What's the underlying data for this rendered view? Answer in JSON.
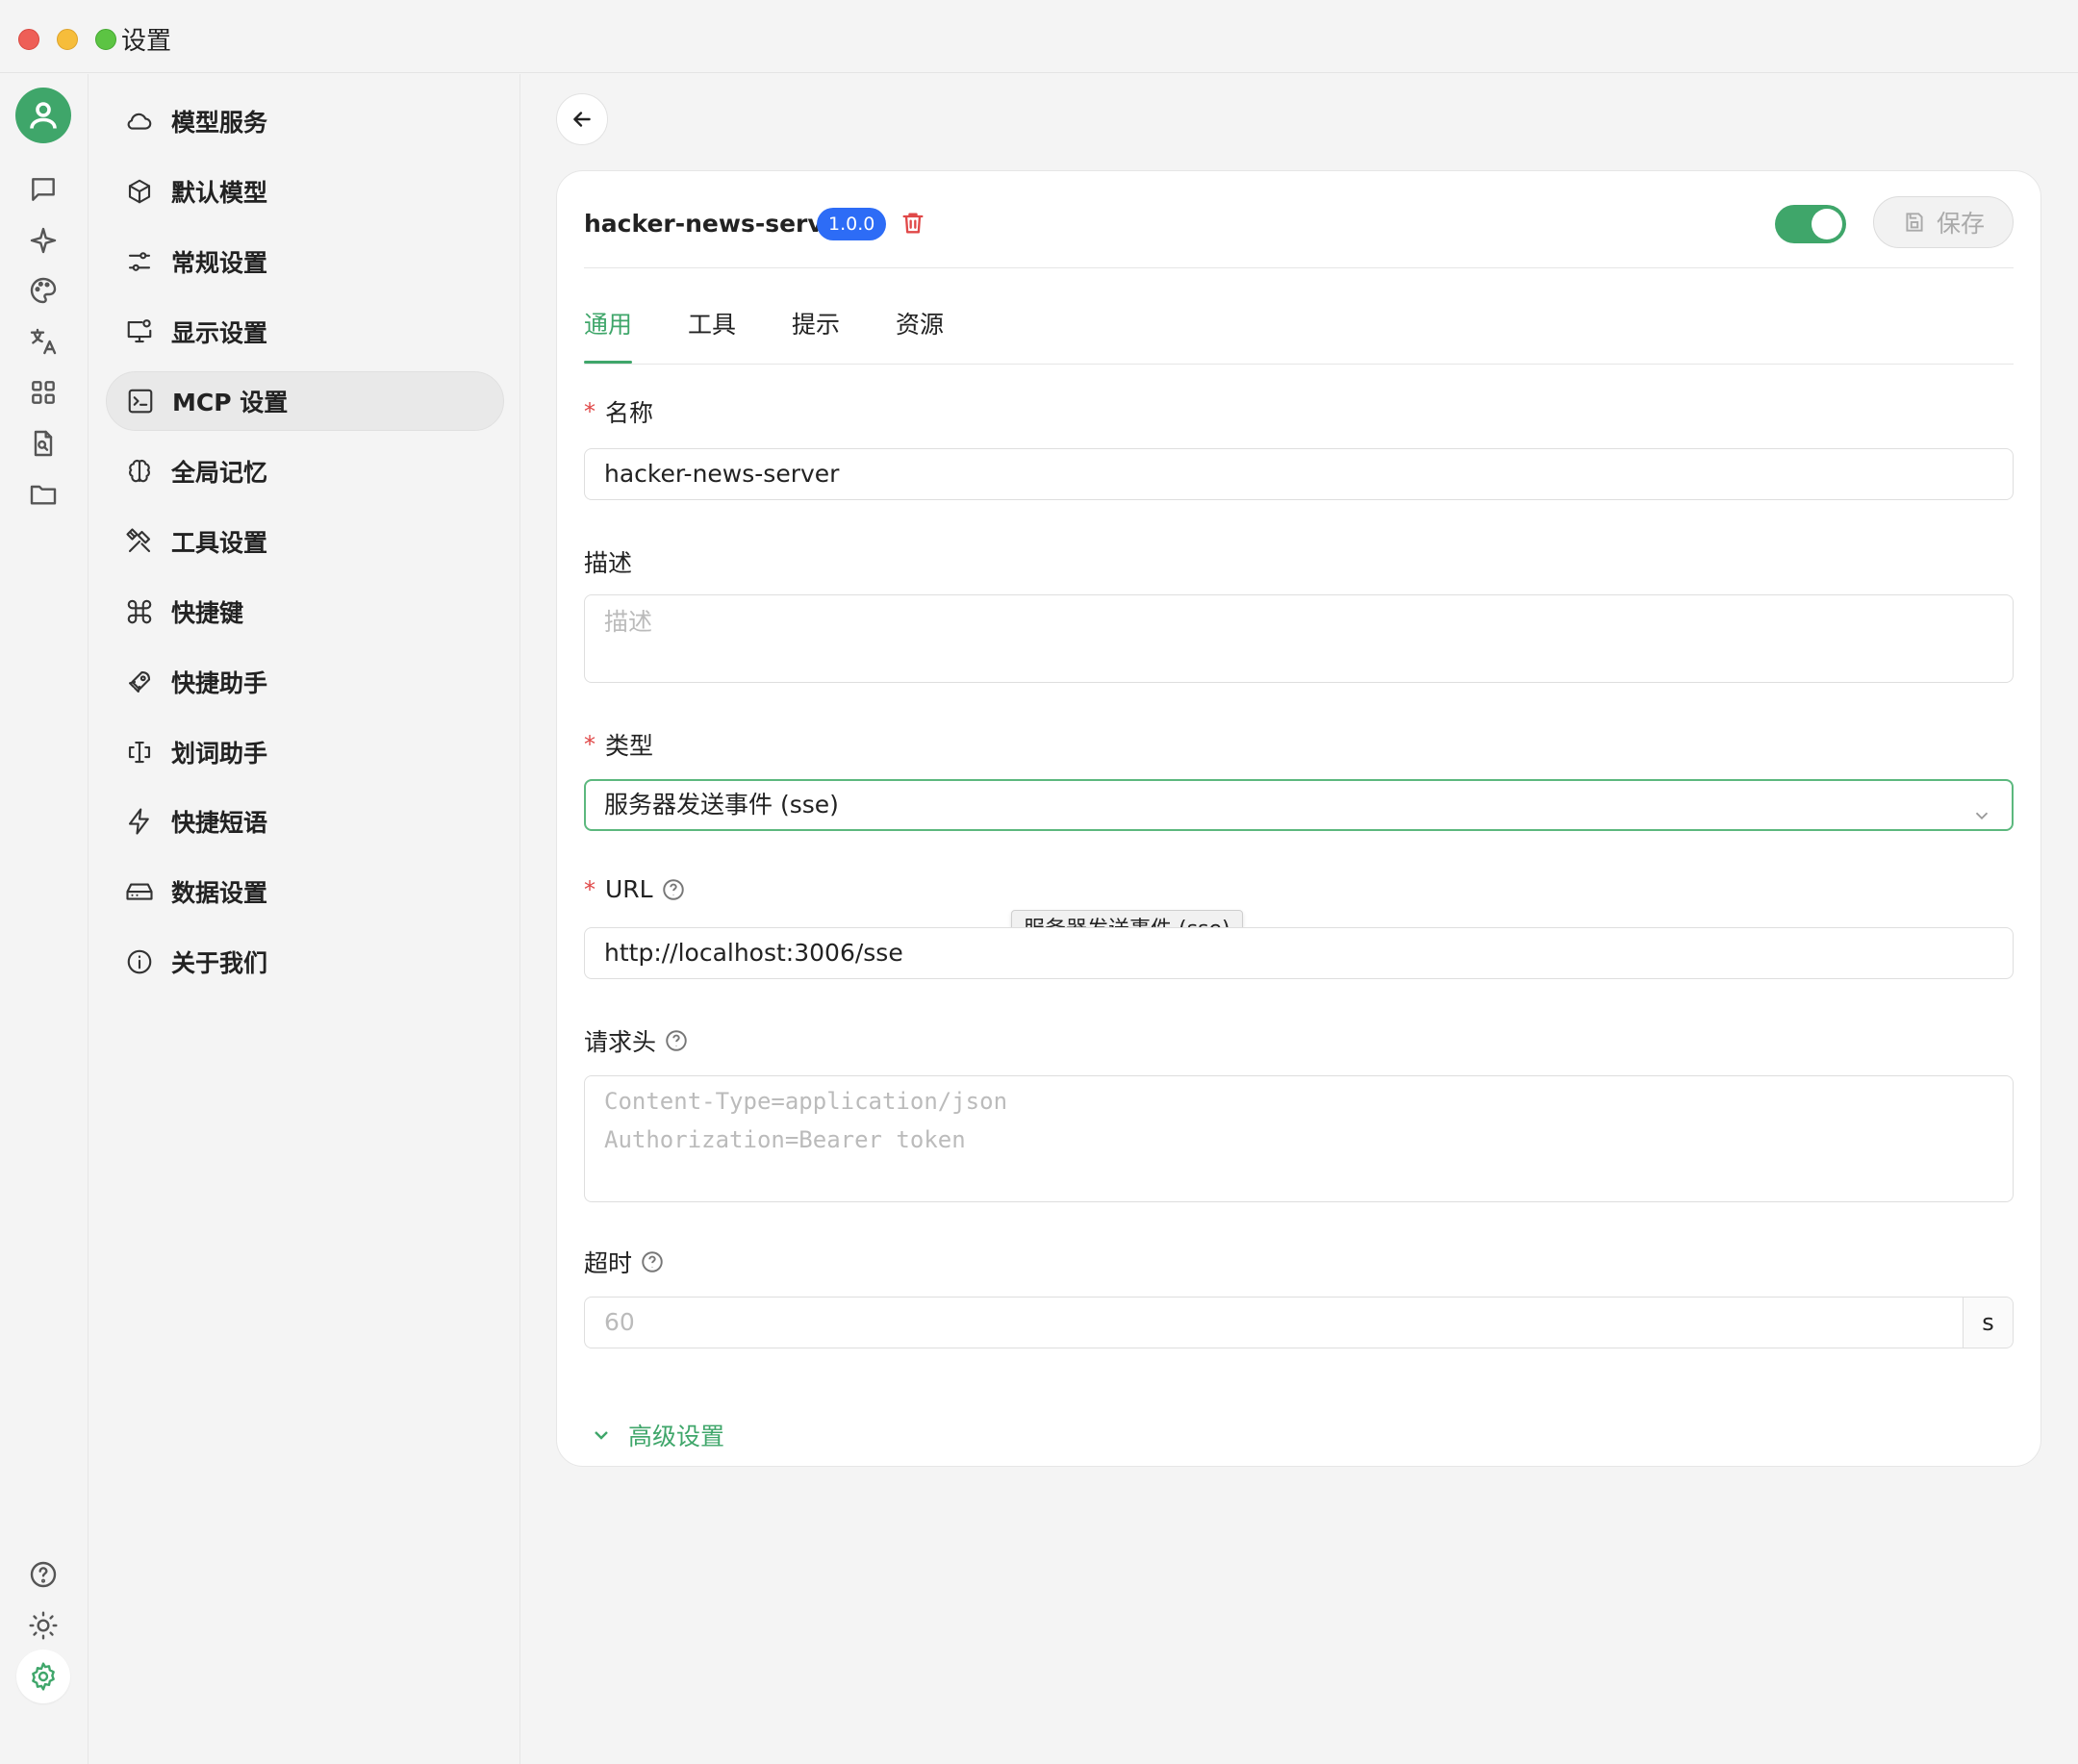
{
  "window": {
    "title": "设置"
  },
  "sidebar": {
    "items": [
      {
        "label": "模型服务",
        "icon": "cloud-icon"
      },
      {
        "label": "默认模型",
        "icon": "cube-icon"
      },
      {
        "label": "常规设置",
        "icon": "sliders-icon"
      },
      {
        "label": "显示设置",
        "icon": "monitor-icon"
      },
      {
        "label": "MCP 设置",
        "icon": "terminal-icon",
        "active": true
      },
      {
        "label": "全局记忆",
        "icon": "brain-icon"
      },
      {
        "label": "工具设置",
        "icon": "tools-icon"
      },
      {
        "label": "快捷键",
        "icon": "command-icon"
      },
      {
        "label": "快捷助手",
        "icon": "rocket-icon"
      },
      {
        "label": "划词助手",
        "icon": "text-cursor-icon"
      },
      {
        "label": "快捷短语",
        "icon": "zap-icon"
      },
      {
        "label": "数据设置",
        "icon": "hard-drive-icon"
      },
      {
        "label": "关于我们",
        "icon": "info-icon"
      }
    ]
  },
  "server": {
    "name": "hacker-news-server",
    "version": "1.0.0",
    "enabled": true,
    "save_label": "保存"
  },
  "tabs": [
    "通用",
    "工具",
    "提示",
    "资源"
  ],
  "form": {
    "name": {
      "label": "名称",
      "value": "hacker-news-server"
    },
    "description": {
      "label": "描述",
      "placeholder": "描述"
    },
    "type": {
      "label": "类型",
      "value": "服务器发送事件 (sse)",
      "tooltip": "服务器发送事件 (sse)"
    },
    "url": {
      "label": "URL",
      "value": "http://localhost:3006/sse"
    },
    "headers": {
      "label": "请求头",
      "placeholder_line1": "Content-Type=application/json",
      "placeholder_line2": "Authorization=Bearer token"
    },
    "timeout": {
      "label": "超时",
      "placeholder": "60",
      "unit": "s"
    },
    "advanced_label": "高级设置"
  },
  "colors": {
    "accent": "#3fa66a",
    "badge": "#2d6cf6",
    "danger": "#e04848"
  }
}
